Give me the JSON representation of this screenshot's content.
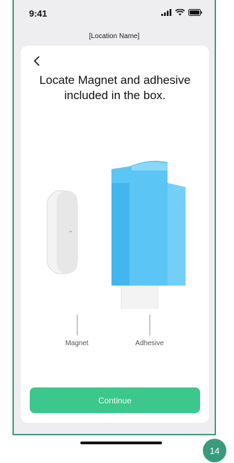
{
  "status": {
    "time": "9:41"
  },
  "header": {
    "location": "[Location Name]"
  },
  "card": {
    "title_line1": "Locate Magnet and adhesive",
    "title_line2": "included in the box.",
    "labels": {
      "magnet": "Magnet",
      "adhesive": "Adhesive"
    },
    "continue_label": "Continue"
  },
  "page_badge": "14",
  "icons": {
    "back": "chevron-left-icon",
    "signal": "signal-icon",
    "wifi": "wifi-icon",
    "battery": "battery-icon"
  },
  "colors": {
    "accent": "#3cc78d",
    "frame": "#3a9a7d",
    "adhesive": "#4fc3f7"
  }
}
